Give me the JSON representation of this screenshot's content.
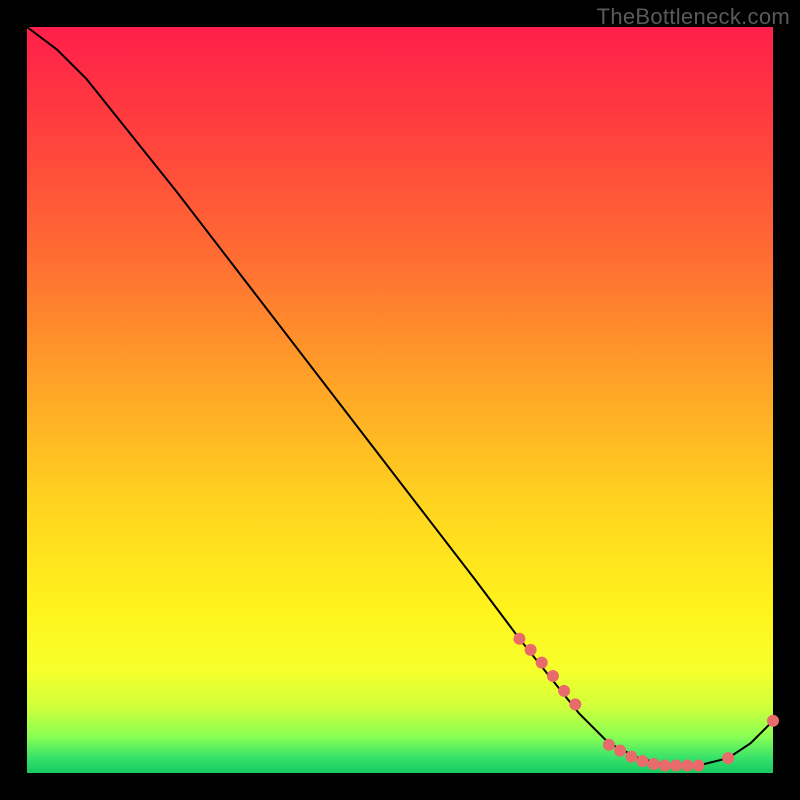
{
  "attribution": "TheBottleneck.com",
  "colors": {
    "page_bg": "#000000",
    "text": "#5a5a5a",
    "curve": "#000000",
    "marker": "#e86a6a"
  },
  "chart_data": {
    "type": "line",
    "title": "",
    "xlabel": "",
    "ylabel": "",
    "xlim": [
      0,
      100
    ],
    "ylim": [
      0,
      100
    ],
    "grid": false,
    "legend": false,
    "series": [
      {
        "name": "bottleneck-curve",
        "x": [
          0,
          4,
          8,
          12,
          20,
          30,
          40,
          50,
          60,
          66,
          70,
          74,
          78,
          82,
          86,
          90,
          94,
          97,
          100
        ],
        "y": [
          100,
          97,
          93,
          88,
          78,
          65,
          52,
          39,
          26,
          18,
          13,
          8,
          4,
          2,
          1,
          1,
          2,
          4,
          7
        ]
      }
    ],
    "markers": {
      "name": "highlight-points",
      "x": [
        66,
        67.5,
        69,
        70.5,
        72,
        73.5,
        78,
        79.5,
        81,
        82.5,
        84,
        85.5,
        87,
        88.5,
        90,
        94,
        100
      ],
      "y": [
        18,
        16.5,
        14.8,
        13,
        11,
        9.2,
        3.8,
        3.0,
        2.2,
        1.6,
        1.2,
        1.0,
        1.0,
        1.0,
        1.0,
        2.0,
        7
      ]
    }
  }
}
